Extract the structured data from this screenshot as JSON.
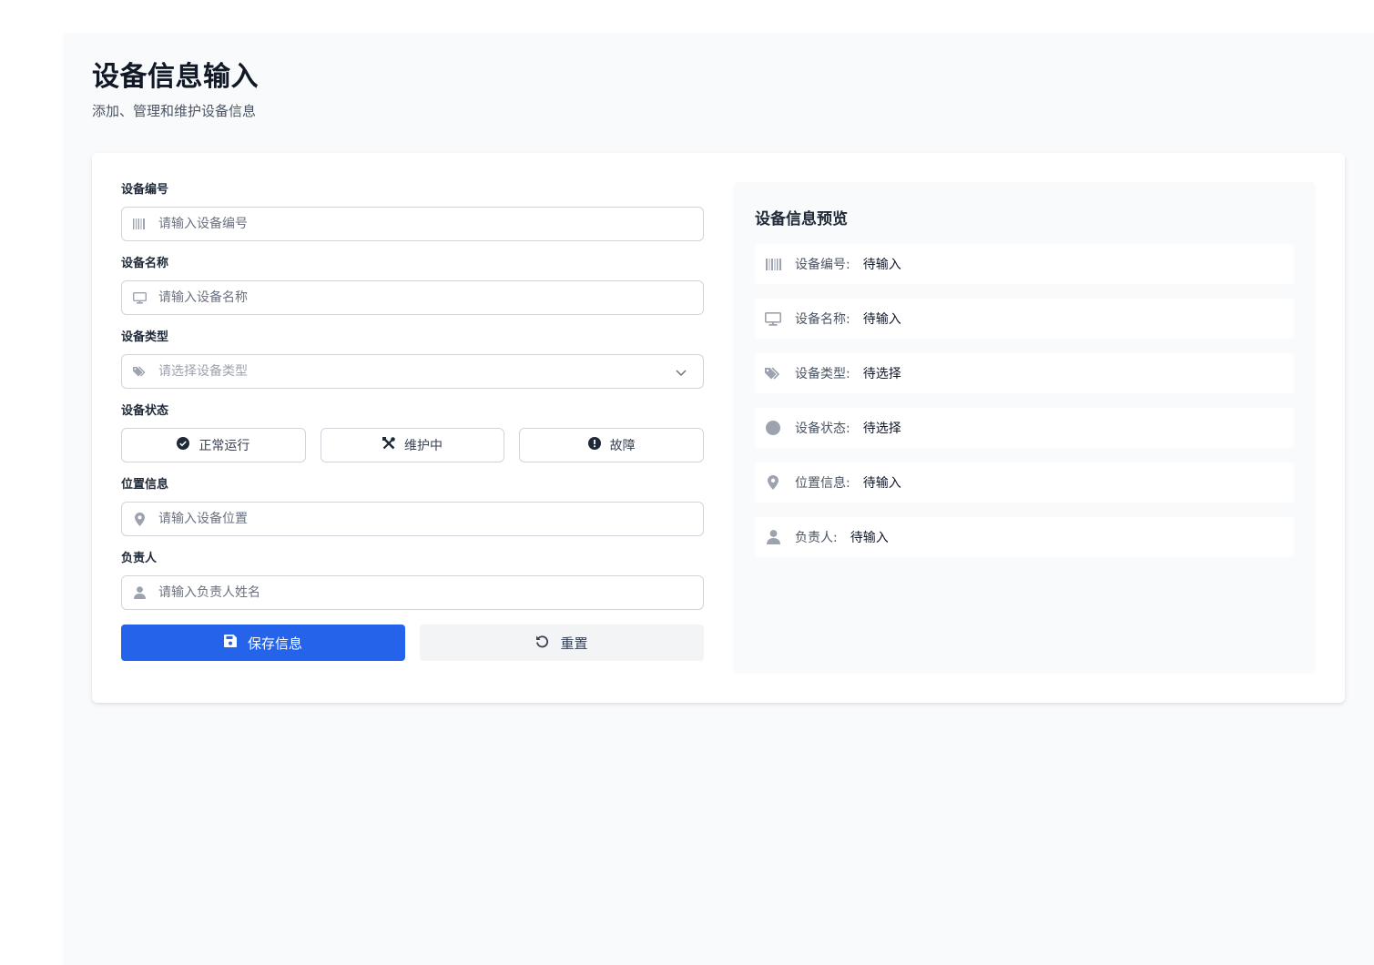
{
  "header": {
    "title": "设备信息输入",
    "subtitle": "添加、管理和维护设备信息"
  },
  "form": {
    "device_id": {
      "label": "设备编号",
      "placeholder": "请输入设备编号",
      "value": ""
    },
    "device_name": {
      "label": "设备名称",
      "placeholder": "请输入设备名称",
      "value": ""
    },
    "device_type": {
      "label": "设备类型",
      "placeholder": "请选择设备类型"
    },
    "device_status": {
      "label": "设备状态",
      "options": [
        {
          "label": "正常运行",
          "icon": "check-circle-icon"
        },
        {
          "label": "维护中",
          "icon": "tools-icon"
        },
        {
          "label": "故障",
          "icon": "exclamation-circle-icon"
        }
      ]
    },
    "location": {
      "label": "位置信息",
      "placeholder": "请输入设备位置",
      "value": ""
    },
    "owner": {
      "label": "负责人",
      "placeholder": "请输入负责人姓名",
      "value": ""
    },
    "save_label": "保存信息",
    "reset_label": "重置"
  },
  "preview": {
    "title": "设备信息预览",
    "rows": [
      {
        "icon": "barcode-icon",
        "label": "设备编号:",
        "value": "待输入"
      },
      {
        "icon": "monitor-icon",
        "label": "设备名称:",
        "value": "待输入"
      },
      {
        "icon": "tags-icon",
        "label": "设备类型:",
        "value": "待选择"
      },
      {
        "icon": "circle-icon",
        "label": "设备状态:",
        "value": "待选择"
      },
      {
        "icon": "map-marker-icon",
        "label": "位置信息:",
        "value": "待输入"
      },
      {
        "icon": "user-icon",
        "label": "负责人:",
        "value": "待输入"
      }
    ]
  },
  "colors": {
    "primary": "#2563eb",
    "icon_gray": "#9ca3af",
    "page_bg": "#f9fafb"
  }
}
